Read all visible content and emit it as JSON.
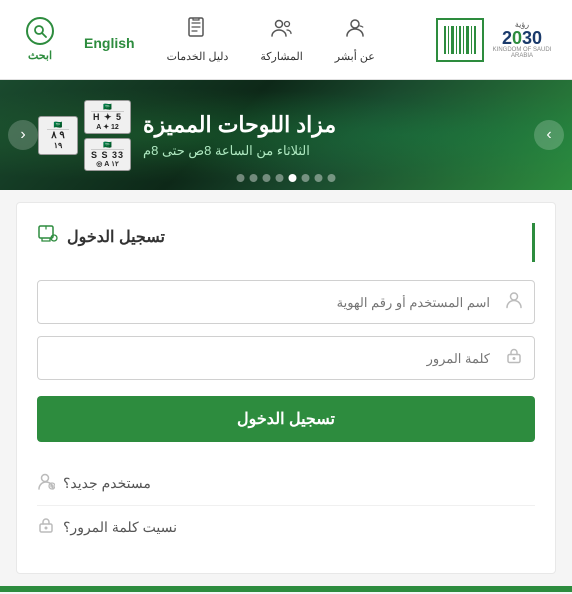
{
  "header": {
    "search_label": "ابحث",
    "english_label": "English",
    "nav_items": [
      {
        "id": "services",
        "label": "دليل الخدمات",
        "icon": "📖"
      },
      {
        "id": "participation",
        "label": "المشاركة",
        "icon": "👥"
      },
      {
        "id": "absher",
        "label": "عن أبشر",
        "icon": "💬"
      }
    ],
    "vision_line1": "رؤية",
    "vision_year": "2030",
    "vision_country": "KINGDOM OF SAUDI ARABIA"
  },
  "banner": {
    "title": "مزاد اللوحات المميزة",
    "subtitle": "الثلاثاء من الساعة 8ص حتى 8م",
    "arrow_right": "›",
    "arrow_left": "‹",
    "dots_count": 8,
    "active_dot": 4,
    "plates": [
      {
        "top": "5",
        "mid": "🇸🇦 H",
        "bot": "12 ✦"
      },
      {
        "top": "33",
        "mid": "S S",
        "bot": "A ◎"
      },
      {
        "top": "٩ ٨",
        "mid": "",
        "bot": ""
      }
    ]
  },
  "login": {
    "section_title": "تسجيل الدخول",
    "username_placeholder": "اسم المستخدم أو رقم الهوية",
    "password_placeholder": "كلمة المرور",
    "login_button": "تسجيل الدخول",
    "new_user_label": "مستخدم جديد؟",
    "forgot_password_label": "نسيت كلمة المرور؟",
    "user_icon": "👤",
    "lock_icon": "🔒",
    "new_user_icon": "👤",
    "forgot_icon": "🔒",
    "title_icon": "🖥"
  }
}
